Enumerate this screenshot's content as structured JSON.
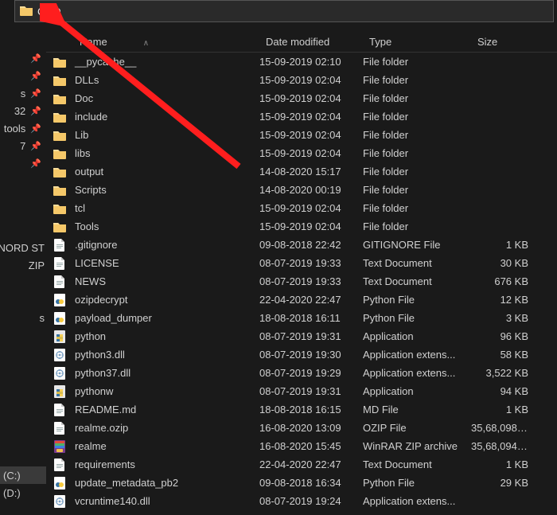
{
  "addressbar": {
    "value": "CMD"
  },
  "columns": {
    "name": "Name",
    "date": "Date modified",
    "type": "Type",
    "size": "Size"
  },
  "nav": {
    "quick": [
      {
        "label": "",
        "pin": false
      },
      {
        "label": "",
        "pin": true
      },
      {
        "label": "",
        "pin": true
      },
      {
        "label": "s",
        "pin": true
      },
      {
        "label": "32",
        "pin": true
      },
      {
        "label": "tools",
        "pin": true
      },
      {
        "label": "7",
        "pin": true
      },
      {
        "label": "",
        "pin": true
      }
    ],
    "items": [
      "NORD ST",
      "ZIP",
      "",
      "",
      "s",
      "",
      "",
      "",
      "",
      "",
      "",
      "",
      "",
      "(C:)",
      "(D:)"
    ]
  },
  "files": [
    {
      "name": "__pycache__",
      "date": "15-09-2019 02:10",
      "type": "File folder",
      "size": "",
      "icon": "folder"
    },
    {
      "name": "DLLs",
      "date": "15-09-2019 02:04",
      "type": "File folder",
      "size": "",
      "icon": "folder"
    },
    {
      "name": "Doc",
      "date": "15-09-2019 02:04",
      "type": "File folder",
      "size": "",
      "icon": "folder"
    },
    {
      "name": "include",
      "date": "15-09-2019 02:04",
      "type": "File folder",
      "size": "",
      "icon": "folder"
    },
    {
      "name": "Lib",
      "date": "15-09-2019 02:04",
      "type": "File folder",
      "size": "",
      "icon": "folder"
    },
    {
      "name": "libs",
      "date": "15-09-2019 02:04",
      "type": "File folder",
      "size": "",
      "icon": "folder"
    },
    {
      "name": "output",
      "date": "14-08-2020 15:17",
      "type": "File folder",
      "size": "",
      "icon": "folder"
    },
    {
      "name": "Scripts",
      "date": "14-08-2020 00:19",
      "type": "File folder",
      "size": "",
      "icon": "folder"
    },
    {
      "name": "tcl",
      "date": "15-09-2019 02:04",
      "type": "File folder",
      "size": "",
      "icon": "folder"
    },
    {
      "name": "Tools",
      "date": "15-09-2019 02:04",
      "type": "File folder",
      "size": "",
      "icon": "folder"
    },
    {
      "name": ".gitignore",
      "date": "09-08-2018 22:42",
      "type": "GITIGNORE File",
      "size": "1 KB",
      "icon": "file"
    },
    {
      "name": "LICENSE",
      "date": "08-07-2019 19:33",
      "type": "Text Document",
      "size": "30 KB",
      "icon": "file"
    },
    {
      "name": "NEWS",
      "date": "08-07-2019 19:33",
      "type": "Text Document",
      "size": "676 KB",
      "icon": "file"
    },
    {
      "name": "ozipdecrypt",
      "date": "22-04-2020 22:47",
      "type": "Python File",
      "size": "12 KB",
      "icon": "python"
    },
    {
      "name": "payload_dumper",
      "date": "18-08-2018 16:11",
      "type": "Python File",
      "size": "3 KB",
      "icon": "python"
    },
    {
      "name": "python",
      "date": "08-07-2019 19:31",
      "type": "Application",
      "size": "96 KB",
      "icon": "pyexe"
    },
    {
      "name": "python3.dll",
      "date": "08-07-2019 19:30",
      "type": "Application extens...",
      "size": "58 KB",
      "icon": "dll"
    },
    {
      "name": "python37.dll",
      "date": "08-07-2019 19:29",
      "type": "Application extens...",
      "size": "3,522 KB",
      "icon": "dll"
    },
    {
      "name": "pythonw",
      "date": "08-07-2019 19:31",
      "type": "Application",
      "size": "94 KB",
      "icon": "pyexe"
    },
    {
      "name": "README.md",
      "date": "18-08-2018 16:15",
      "type": "MD File",
      "size": "1 KB",
      "icon": "file"
    },
    {
      "name": "realme.ozip",
      "date": "16-08-2020 13:09",
      "type": "OZIP File",
      "size": "35,68,098 ...",
      "icon": "file"
    },
    {
      "name": "realme",
      "date": "16-08-2020 15:45",
      "type": "WinRAR ZIP archive",
      "size": "35,68,094 ...",
      "icon": "zip"
    },
    {
      "name": "requirements",
      "date": "22-04-2020 22:47",
      "type": "Text Document",
      "size": "1 KB",
      "icon": "file"
    },
    {
      "name": "update_metadata_pb2",
      "date": "09-08-2018 16:34",
      "type": "Python File",
      "size": "29 KB",
      "icon": "python"
    },
    {
      "name": "vcruntime140.dll",
      "date": "08-07-2019 19:24",
      "type": "Application extens...",
      "size": "",
      "icon": "dll"
    }
  ]
}
